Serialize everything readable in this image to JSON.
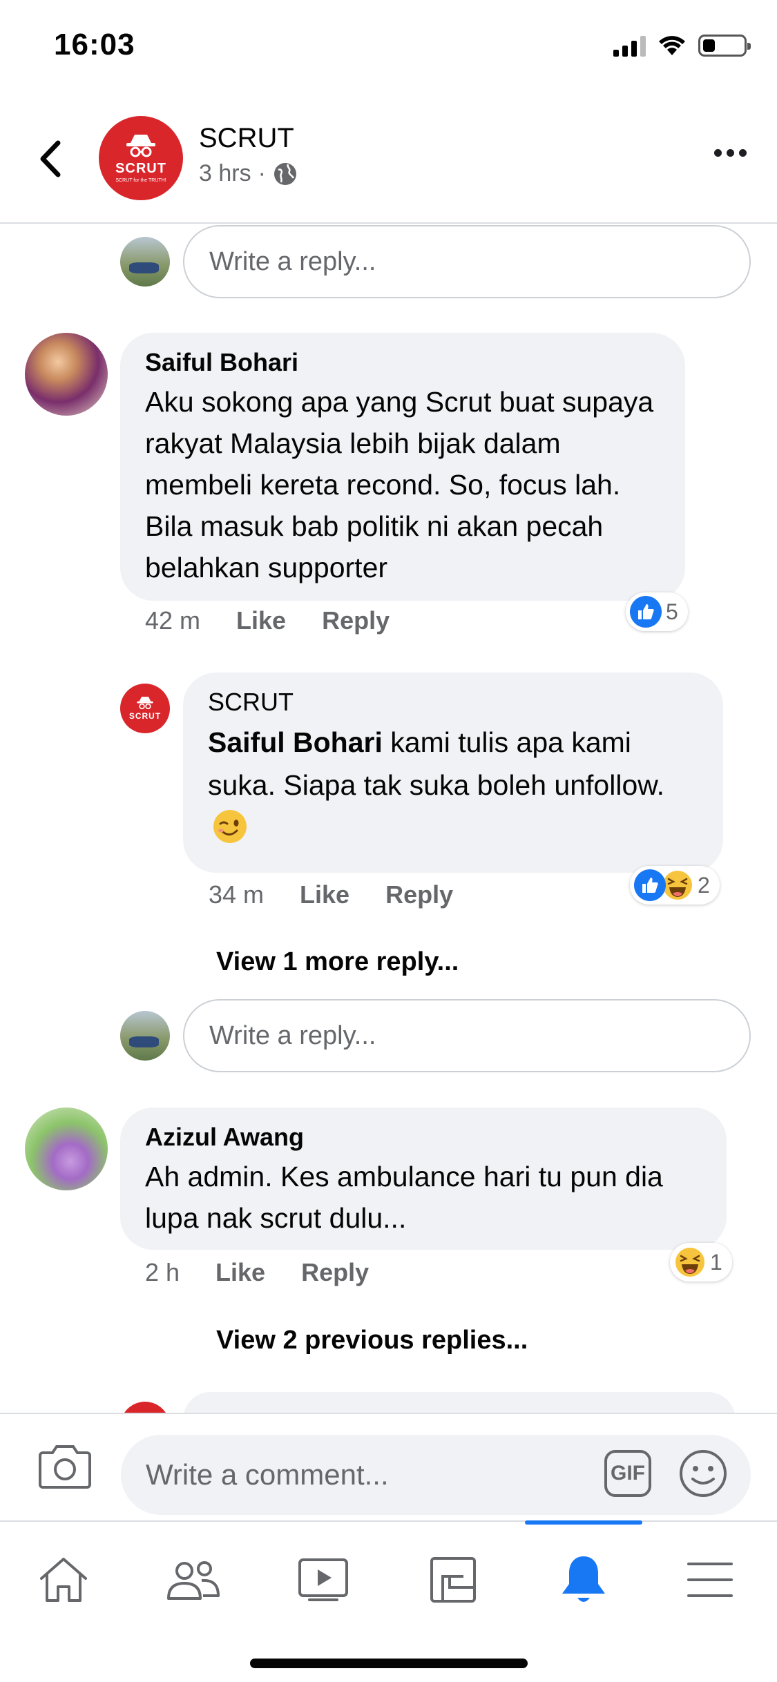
{
  "status_bar": {
    "time": "16:03",
    "battery_level": 0.3
  },
  "header": {
    "page_name": "SCRUT",
    "post_age": "3 hrs",
    "logo_text": "SCRUT",
    "logo_tagline": "SCRUT for the TRUTH!"
  },
  "reply_placeholder": "Write a reply...",
  "comments": [
    {
      "author": "Saiful Bohari",
      "text": "Aku sokong apa yang Scrut buat supaya rakyat Malaysia lebih bijak dalam membeli kereta recond. So, focus lah. Bila masuk bab politik ni akan pecah belahkan supporter",
      "time": "42 m",
      "like_label": "Like",
      "reply_label": "Reply",
      "reaction_count": "5",
      "reply": {
        "author": "SCRUT",
        "mention": "Saiful Bohari",
        "text": " kami tulis apa kami suka. Siapa tak suka boleh unfollow.",
        "time": "34 m",
        "like_label": "Like",
        "reply_label": "Reply",
        "reaction_count": "2"
      },
      "view_more": "View 1 more reply..."
    },
    {
      "author": "Azizul Awang",
      "text": "Ah admin. Kes ambulance hari tu pun dia lupa nak scrut dulu...",
      "time": "2 h",
      "like_label": "Like",
      "reply_label": "Reply",
      "reaction_count": "1",
      "view_more": "View 2 previous replies..."
    }
  ],
  "composer": {
    "placeholder": "Write a comment...",
    "gif_label": "GIF"
  },
  "tabs": [
    "home",
    "friends",
    "watch",
    "pages",
    "notifications",
    "menu"
  ],
  "colors": {
    "accent": "#1877f2",
    "brand": "#d9262b",
    "bubble": "#f0f2f5",
    "muted": "#65676b"
  }
}
